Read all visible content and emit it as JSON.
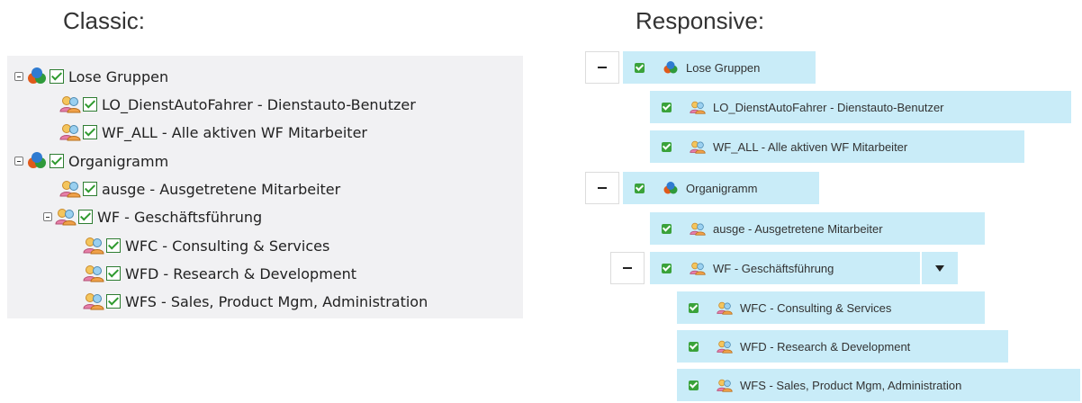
{
  "headings": {
    "classic": "Classic:",
    "responsive": "Responsive:"
  },
  "tree": {
    "lose_gruppen": "Lose Gruppen",
    "lo_dienst": "LO_DienstAutoFahrer - Dienstauto-Benutzer",
    "wf_all": "WF_ALL - Alle aktiven WF Mitarbeiter",
    "organigramm": "Organigramm",
    "ausge": "ausge - Ausgetretene Mitarbeiter",
    "wf": "WF - Geschäftsführung",
    "wfc": "WFC - Consulting & Services",
    "wfd": "WFD - Research & Development",
    "wfs": "WFS - Sales, Product Mgm, Administration"
  },
  "icons": {
    "root": "group-cluster-icon",
    "node": "users-group-icon",
    "checked": "checkbox-checked-icon",
    "collapse": "collapse-minus-icon",
    "dropdown": "caret-down-icon"
  }
}
